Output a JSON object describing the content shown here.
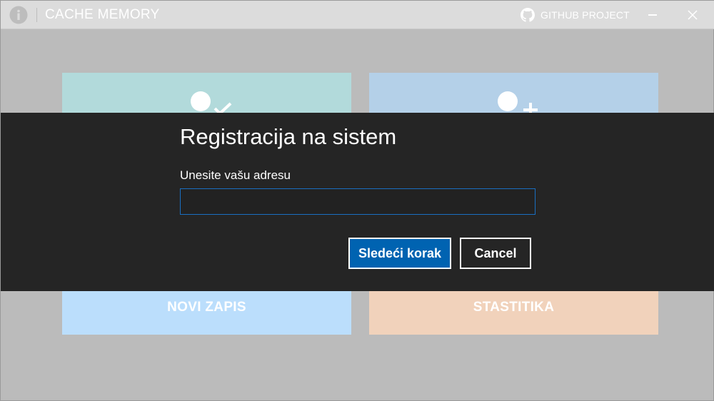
{
  "window": {
    "app_title": "CACHE MEMORY",
    "github_label": "GITHUB PROJECT",
    "icons": [
      "info-icon",
      "github-icon",
      "minimize-icon",
      "close-icon"
    ]
  },
  "tiles": {
    "top_left": {
      "icon": "user-check-icon",
      "color": "#b2dadb"
    },
    "top_right": {
      "icon": "user-add-icon",
      "color": "#b4d0e8"
    },
    "bottom_left": {
      "label": "NOVI ZAPIS",
      "color": "#bbdefc"
    },
    "bottom_right": {
      "label": "STASTITIKA",
      "color": "#f1d2bb"
    }
  },
  "dialog": {
    "title": "Registracija na sistem",
    "field_label": "Unesite vašu adresu",
    "field_value": "",
    "field_placeholder": "",
    "next_button": "Sledeći korak",
    "cancel_button": "Cancel"
  },
  "colors": {
    "dialog_bg": "#252525",
    "accent": "#0063b1",
    "overlay": "#bbbbbb"
  }
}
